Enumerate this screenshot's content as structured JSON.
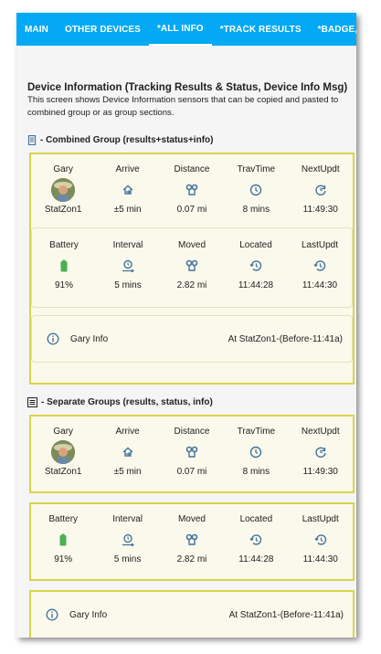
{
  "tabs": [
    "MAIN",
    "OTHER DEVICES",
    "*ALL INFO",
    "*TRACK RESULTS",
    "*BADGE, BAT"
  ],
  "active_tab": "*ALL INFO",
  "header": {
    "title": "Device Information (Tracking Results & Status, Device Info Msg)",
    "desc_line1": "This screen shows Device Information sensors that can be copied and pasted to",
    "desc_line2": "combined group or as group sections."
  },
  "combined": {
    "title": "- Combined Group (results+status+info)",
    "results": {
      "labels": [
        "Gary",
        "Arrive",
        "Distance",
        "TravTime",
        "NextUpdt"
      ],
      "values": [
        "StatZon1",
        "±5 min",
        "0.07 mi",
        "8 mins",
        "11:49:30"
      ],
      "icons": [
        "avatar",
        "arrive-icon",
        "distance-icon",
        "clock-icon",
        "refresh-clock-icon"
      ]
    },
    "status": {
      "labels": [
        "Battery",
        "Interval",
        "Moved",
        "Located",
        "LastUpdt"
      ],
      "values": [
        "91%",
        "5 mins",
        "2.82 mi",
        "11:44:28",
        "11:44:30"
      ],
      "icons": [
        "battery-icon",
        "interval-icon",
        "moved-icon",
        "history-icon",
        "history-icon"
      ]
    },
    "info": {
      "name": "Gary Info",
      "location": "At StatZon1-(Before-11:41a)"
    }
  },
  "separate": {
    "title": "- Separate Groups (results, status, info)",
    "results": {
      "labels": [
        "Gary",
        "Arrive",
        "Distance",
        "TravTime",
        "NextUpdt"
      ],
      "values": [
        "StatZon1",
        "±5 min",
        "0.07 mi",
        "8 mins",
        "11:49:30"
      ]
    },
    "status": {
      "labels": [
        "Battery",
        "Interval",
        "Moved",
        "Located",
        "LastUpdt"
      ],
      "values": [
        "91%",
        "5 mins",
        "2.82 mi",
        "11:44:28",
        "11:44:30"
      ]
    },
    "info": {
      "name": "Gary Info",
      "location": "At StatZon1-(Before-11:41a)"
    }
  },
  "colors": {
    "tabbar": "#03a9f4",
    "icon": "#44739e",
    "battery": "#4caf50",
    "border": "#d8d44a"
  }
}
